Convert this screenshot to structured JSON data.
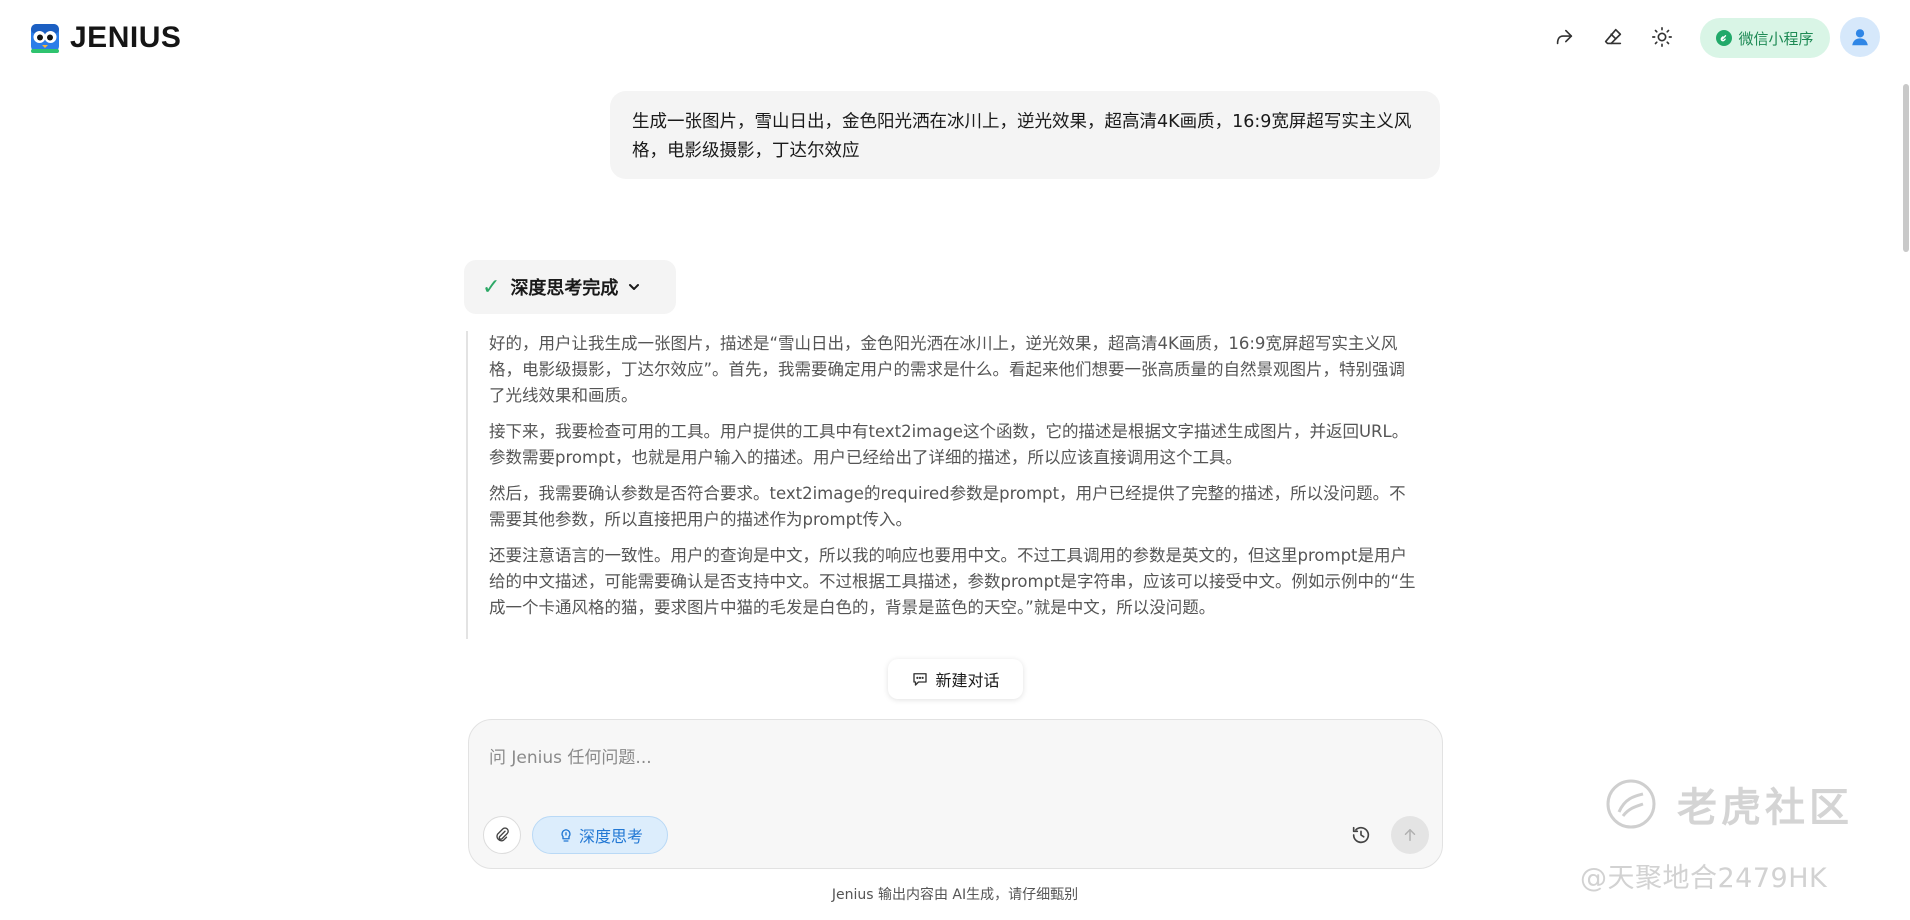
{
  "header": {
    "brand": "JENIUS",
    "mini_program_label": "微信小程序"
  },
  "conversation": {
    "user_message": "生成一张图片，雪山日出，金色阳光洒在冰川上，逆光效果，超高清4K画质，16:9宽屏超写实主义风格，电影级摄影，丁达尔效应",
    "thinking_status": "深度思考完成",
    "reasoning_paragraphs": [
      "好的，用户让我生成一张图片，描述是“雪山日出，金色阳光洒在冰川上，逆光效果，超高清4K画质，16:9宽屏超写实主义风格，电影级摄影，丁达尔效应”。首先，我需要确定用户的需求是什么。看起来他们想要一张高质量的自然景观图片，特别强调了光线效果和画质。",
      "接下来，我要检查可用的工具。用户提供的工具中有text2image这个函数，它的描述是根据文字描述生成图片，并返回URL。参数需要prompt，也就是用户输入的描述。用户已经给出了详细的描述，所以应该直接调用这个工具。",
      "然后，我需要确认参数是否符合要求。text2image的required参数是prompt，用户已经提供了完整的描述，所以没问题。不需要其他参数，所以直接把用户的描述作为prompt传入。",
      "还要注意语言的一致性。用户的查询是中文，所以我的响应也要用中文。不过工具调用的参数是英文的，但这里prompt是用户给的中文描述，可能需要确认是否支持中文。不过根据工具描述，参数prompt是字符串，应该可以接受中文。例如示例中的“生成一个卡通风格的猫，要求图片中猫的毛发是白色的，背景是蓝色的天空。”就是中文，所以没问题。"
    ]
  },
  "new_chat_label": "新建对话",
  "composer": {
    "placeholder": "问 Jenius 任何问题...",
    "deep_think_label": "深度思考"
  },
  "disclaimer": "Jenius 输出内容由 AI生成，请仔细甄别",
  "watermark": {
    "title": "老虎社区",
    "subtitle": "@天聚地合2479HK"
  },
  "colors": {
    "accent_green": "#22a96a",
    "accent_blue": "#2278d4",
    "bubble_bg": "#f4f4f4"
  },
  "icons": [
    "share-icon",
    "eraser-icon",
    "sun-icon",
    "wechat-icon",
    "user-icon",
    "check-icon",
    "chevron-down-icon",
    "chat-bubble-icon",
    "paperclip-icon",
    "bulb-icon",
    "history-icon",
    "arrow-up-icon"
  ]
}
